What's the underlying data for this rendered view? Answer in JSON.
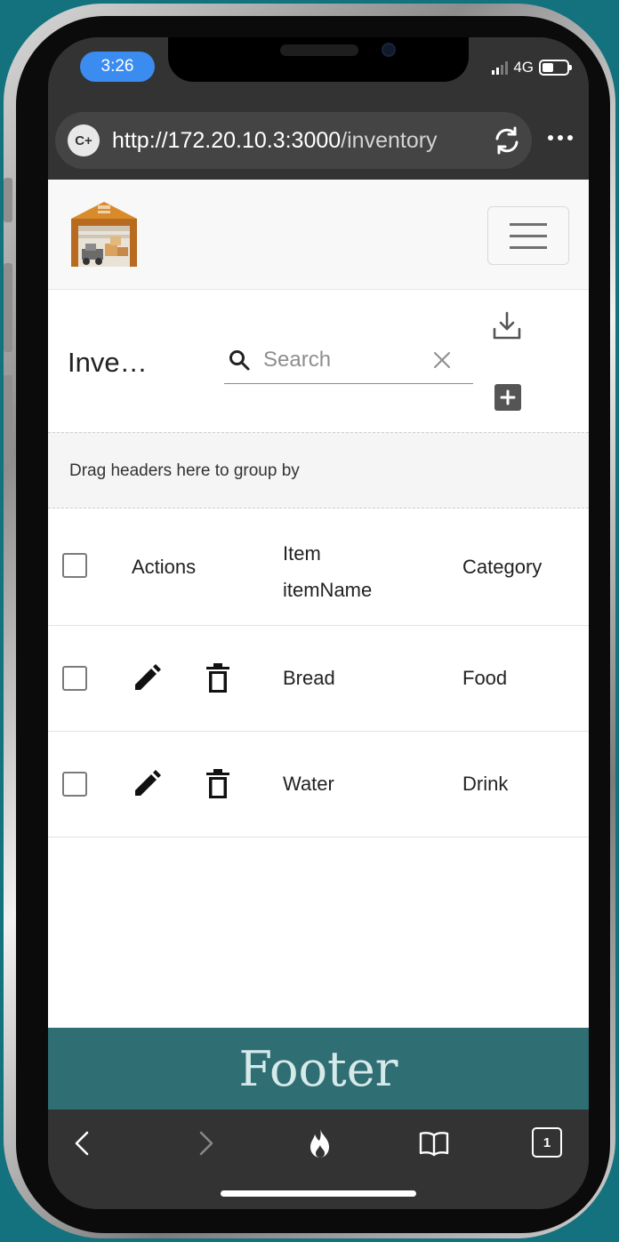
{
  "status_bar": {
    "time": "3:26",
    "network": "4G",
    "battery_level": 0.45
  },
  "browser": {
    "site_badge": "C+",
    "url_host": "http://172.20.10.3:3000",
    "url_path": "/inventory"
  },
  "header": {
    "logo_icon": "warehouse-icon",
    "menu_icon": "hamburger-menu-icon"
  },
  "toolbar": {
    "title": "Inve…",
    "search_placeholder": "Search",
    "search_value": "",
    "export_icon": "download-icon",
    "add_icon": "add-icon"
  },
  "group_bar": {
    "text": "Drag headers here to group by"
  },
  "grid": {
    "columns": {
      "actions": "Actions",
      "item_line1": "Item",
      "item_line2": "itemName",
      "category": "Category"
    },
    "rows": [
      {
        "item": "Bread",
        "category": "Food"
      },
      {
        "item": "Water",
        "category": "Drink"
      }
    ]
  },
  "footer": {
    "text": "Footer"
  },
  "bottom_nav": {
    "tabs_count": "1"
  },
  "colors": {
    "background": "#13727d",
    "footer": "#2f6e73",
    "time_pill": "#3b8cf0",
    "browser_chrome": "#333333"
  }
}
